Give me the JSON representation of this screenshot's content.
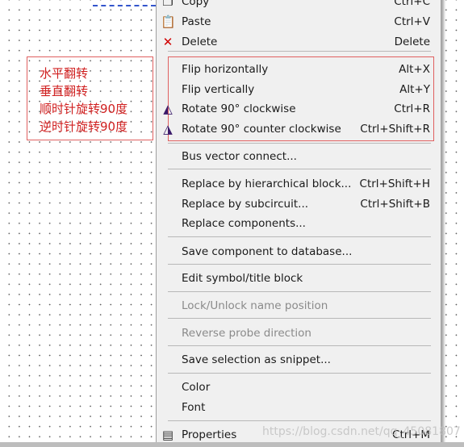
{
  "annotation": {
    "lines": [
      "水平翻转",
      "垂直翻转",
      "顺时针旋转90度",
      "逆时针旋转90度"
    ]
  },
  "menu": {
    "items": [
      {
        "label": "Copy",
        "shortcut": "Ctrl+C",
        "icon": "copy-icon"
      },
      {
        "label": "Paste",
        "shortcut": "Ctrl+V",
        "icon": "paste-icon"
      },
      {
        "label": "Delete",
        "shortcut": "Delete",
        "icon": "delete-x-icon"
      },
      {
        "label": "Flip horizontally",
        "shortcut": "Alt+X"
      },
      {
        "label": "Flip vertically",
        "shortcut": "Alt+Y"
      },
      {
        "label": "Rotate 90° clockwise",
        "shortcut": "Ctrl+R",
        "icon": "rotate-cw-icon"
      },
      {
        "label": "Rotate 90° counter clockwise",
        "shortcut": "Ctrl+Shift+R",
        "icon": "rotate-ccw-icon"
      },
      {
        "label": "Bus vector connect..."
      },
      {
        "label": "Replace by hierarchical block...",
        "shortcut": "Ctrl+Shift+H"
      },
      {
        "label": "Replace by subcircuit...",
        "shortcut": "Ctrl+Shift+B"
      },
      {
        "label": "Replace components..."
      },
      {
        "label": "Save component to database..."
      },
      {
        "label": "Edit symbol/title block"
      },
      {
        "label": "Lock/Unlock name position",
        "disabled": true
      },
      {
        "label": "Reverse probe direction",
        "disabled": true
      },
      {
        "label": "Save selection as snippet..."
      },
      {
        "label": "Color"
      },
      {
        "label": "Font"
      },
      {
        "label": "Properties",
        "shortcut": "Ctrl+M",
        "icon": "properties-icon"
      }
    ]
  },
  "watermark": "https://blog.csdn.net/qq_45081807",
  "colors": {
    "annotation": "#d02020",
    "menu_bg": "#f0f0f0",
    "wire": "#3355cc"
  }
}
